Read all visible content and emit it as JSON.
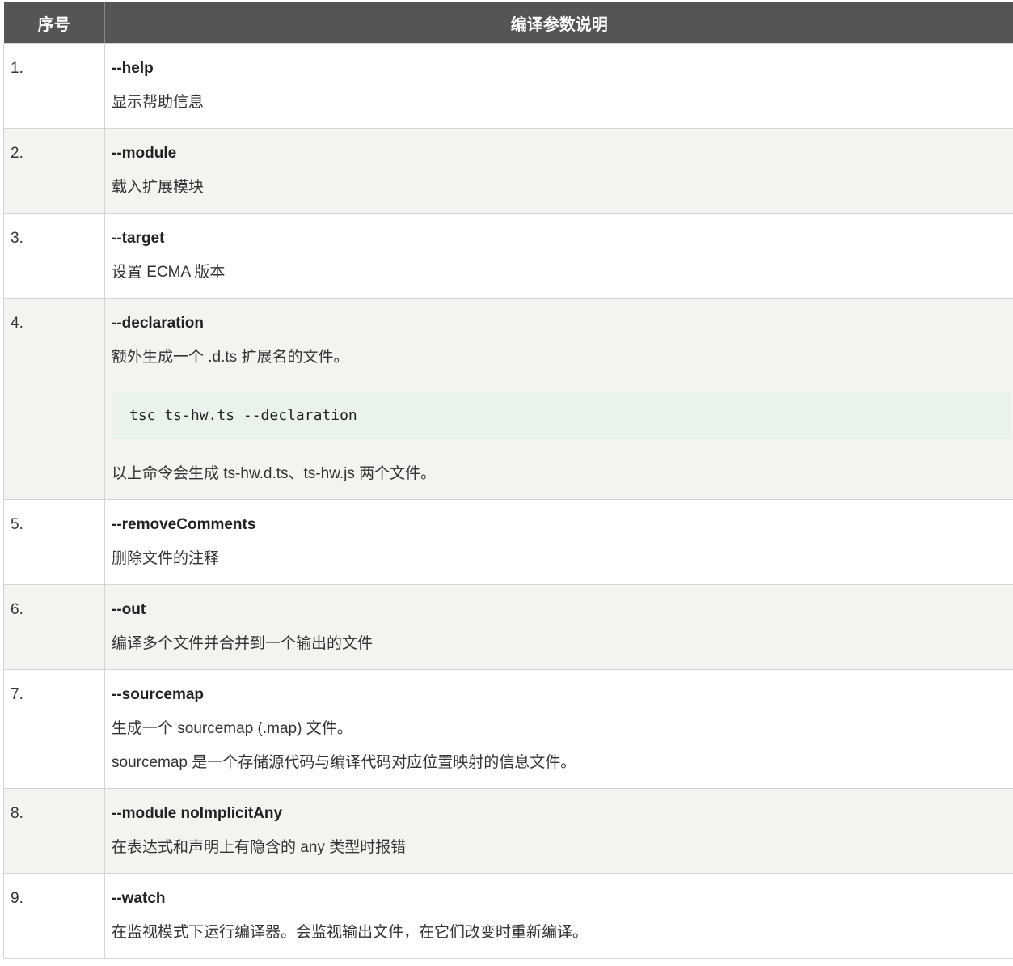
{
  "table": {
    "headers": [
      "序号",
      "编译参数说明"
    ],
    "rows": [
      {
        "num": "1.",
        "name": "--help",
        "desc": [
          "显示帮助信息"
        ]
      },
      {
        "num": "2.",
        "name": "--module",
        "desc": [
          "载入扩展模块"
        ]
      },
      {
        "num": "3.",
        "name": "--target",
        "desc": [
          "设置 ECMA 版本"
        ]
      },
      {
        "num": "4.",
        "name": "--declaration",
        "desc": [
          "额外生成一个 .d.ts 扩展名的文件。"
        ],
        "code": "tsc ts-hw.ts --declaration",
        "after": "以上命令会生成 ts-hw.d.ts、ts-hw.js 两个文件。"
      },
      {
        "num": "5.",
        "name": "--removeComments",
        "desc": [
          "删除文件的注释"
        ]
      },
      {
        "num": "6.",
        "name": "--out",
        "desc": [
          "编译多个文件并合并到一个输出的文件"
        ]
      },
      {
        "num": "7.",
        "name": "--sourcemap",
        "desc": [
          "生成一个 sourcemap (.map) 文件。",
          "sourcemap 是一个存储源代码与编译代码对应位置映射的信息文件。"
        ]
      },
      {
        "num": "8.",
        "name": "--module noImplicitAny",
        "desc": [
          "在表达式和声明上有隐含的 any 类型时报错"
        ]
      },
      {
        "num": "9.",
        "name": "--watch",
        "desc": [
          "在监视模式下运行编译器。会监视输出文件，在它们改变时重新编译。"
        ]
      }
    ]
  }
}
